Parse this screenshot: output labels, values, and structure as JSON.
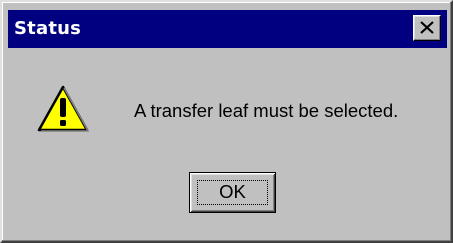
{
  "dialog": {
    "title": "Status",
    "message": "A transfer leaf must be selected.",
    "icon": "warning-icon",
    "ok_label": "OK",
    "close_icon": "close-icon"
  },
  "colors": {
    "titlebar": "#000080",
    "face": "#c0c0c0",
    "warning_yellow": "#ffff00"
  }
}
